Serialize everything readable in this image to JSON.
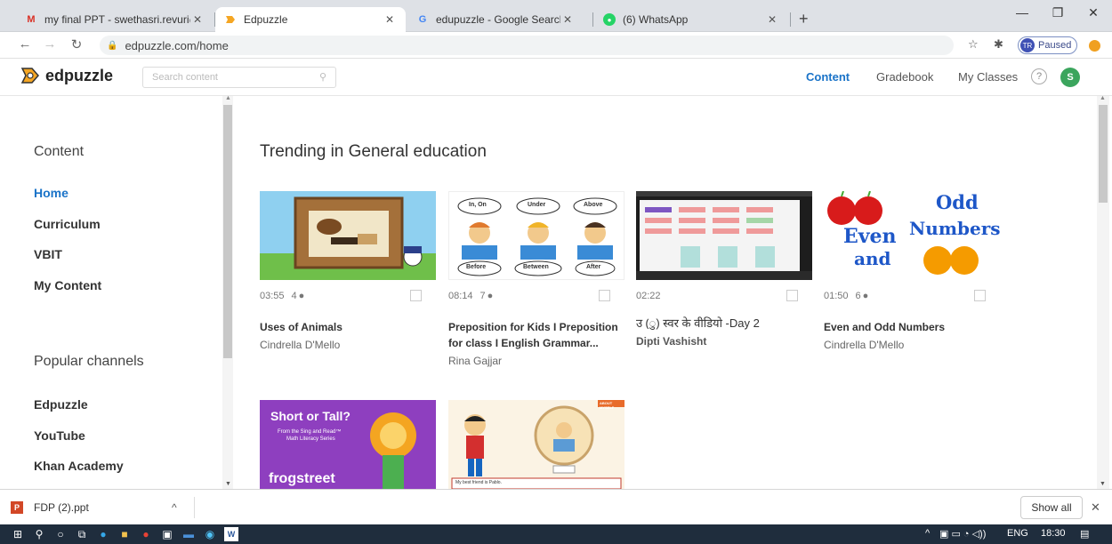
{
  "browser": {
    "tabs": [
      {
        "title": "my final PPT - swethasri.revuri@",
        "icon": "gmail-icon"
      },
      {
        "title": "Edpuzzle",
        "icon": "edpuzzle-icon"
      },
      {
        "title": "edupuzzle - Google Search",
        "icon": "google-icon"
      },
      {
        "title": "(6) WhatsApp",
        "icon": "whatsapp-icon"
      }
    ],
    "url": "edpuzzle.com/home",
    "profile_initials": "TR",
    "profile_status": "Paused"
  },
  "app": {
    "logo_text": "edpuzzle",
    "search_placeholder": "Search content",
    "nav": [
      "Content",
      "Gradebook",
      "My Classes"
    ],
    "help_label": "?",
    "avatar_initial": "S"
  },
  "sidebar": {
    "content_heading": "Content",
    "content_items": [
      "Home",
      "Curriculum",
      "VBIT",
      "My Content"
    ],
    "channels_heading": "Popular channels",
    "channel_items": [
      "Edpuzzle",
      "YouTube",
      "Khan Academy"
    ]
  },
  "main": {
    "section_title": "Trending in General education",
    "videos": [
      {
        "duration": "03:55",
        "questions": "4",
        "title": "Uses of Animals",
        "author": "Cindrella D'Mello"
      },
      {
        "duration": "08:14",
        "questions": "7",
        "title": "Preposition for Kids I Preposition for class I English Grammar...",
        "author": "Rina Gajjar"
      },
      {
        "duration": "02:22",
        "questions": "",
        "title": "उ (ु) स्वर के वीडियो -Day 2",
        "author": "Dipti Vashisht"
      },
      {
        "duration": "01:50",
        "questions": "6",
        "title": "Even and Odd Numbers",
        "author": "Cindrella D'Mello"
      }
    ],
    "thumb_texts": {
      "prepositions": [
        "In, On",
        "Under",
        "Above",
        "Before",
        "Between",
        "After"
      ],
      "even_odd": [
        "Even",
        "and",
        "Odd",
        "Numbers"
      ],
      "short_tall": [
        "Short or Tall?",
        "From the Sing and Read™",
        "Math Literacy Series",
        "frogstreet"
      ],
      "about_myself": [
        "ABOUT MYSELF",
        "My best friend is Pablo."
      ]
    }
  },
  "downloads": {
    "file": "FDP (2).ppt",
    "show_all": "Show all"
  },
  "taskbar": {
    "language": "ENG",
    "time": "18:30"
  },
  "colors": {
    "accent": "#1a73c8",
    "avatar": "#3ba55d",
    "taskbar": "#1f2d3d"
  }
}
